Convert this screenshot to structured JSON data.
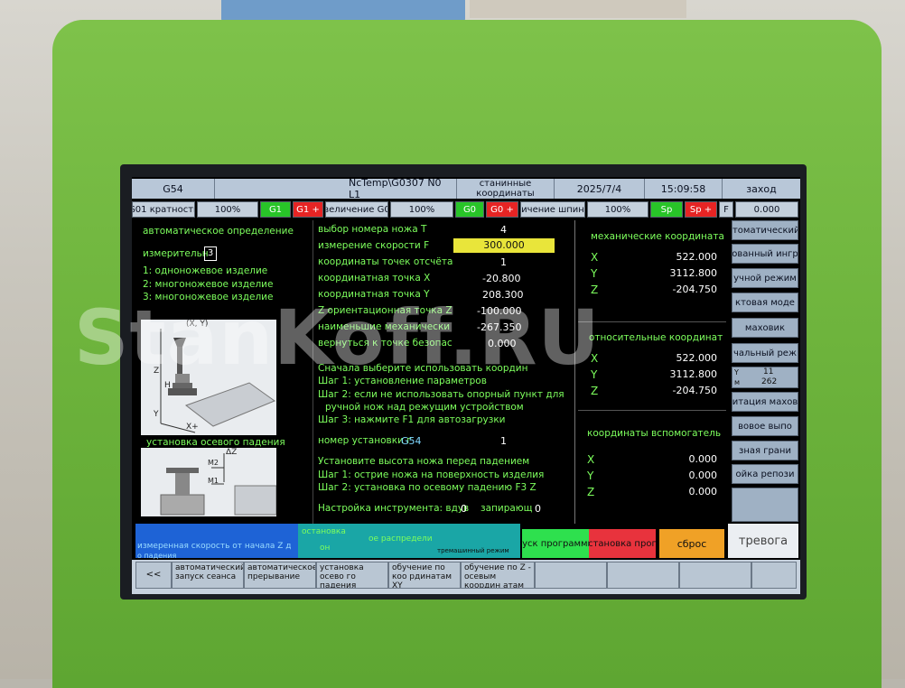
{
  "topbar": {
    "wcs": "G54",
    "program": "NcTemp\\G0307 N0 L1",
    "mode": "станинные координаты",
    "date": "2025/7/4",
    "time": "15:09:58",
    "status": "заход"
  },
  "overrides": {
    "g01_label": "G01 кратность",
    "g01_pct": "100%",
    "g1_btn": "G1",
    "g1_plus": "G1 +",
    "g0_label": "величение G0",
    "g0_pct": "100%",
    "g0_btn": "G0",
    "g0_plus": "G0 +",
    "sp_label": "ичение шпин",
    "sp_pct": "100%",
    "sp_btn": "Sp",
    "sp_plus": "Sp +",
    "f_label": "F",
    "f_value": "0.000"
  },
  "left_panel": {
    "heading": "автоматическое определение",
    "measure_label": "измерительн",
    "measure_value": "3",
    "opt1": "1: одноножевое изделие",
    "opt2": "2: многоножевое изделие",
    "opt3": "3: многоножевое изделие",
    "diagram_label": "(X, Y)",
    "axis_z": "Z",
    "axis_h": "H",
    "axis_y": "Y",
    "axis_x": "X+",
    "section2": "установка осевого падения",
    "dz": "ΔZ",
    "m2": "M2",
    "m1": "M1"
  },
  "params": [
    {
      "label": "выбор номера ножа T",
      "value": "4"
    },
    {
      "label": "измерение скорости F",
      "value": "300.000"
    },
    {
      "label": "координаты точек отсчёта",
      "value": "1"
    },
    {
      "label": "координатная точка X",
      "value": "-20.800"
    },
    {
      "label": "координатная точка Y",
      "value": "208.300"
    },
    {
      "label": "Z ориентационная точка Z",
      "value": "-100.000"
    },
    {
      "label": "наименьшие механически",
      "value": "-267.350"
    },
    {
      "label": "вернуться к точке безопас",
      "value": "0.000"
    }
  ],
  "instructions1": {
    "line1": "Сначала выберите использовать координ",
    "line2": "Шаг 1: установление параметров",
    "line3": "Шаг 2: если не использовать опорный пункт для",
    "line4": "ручной нож над режущим устройством",
    "line5": "Шаг 3: нажмите F1 для автозагрузки"
  },
  "install_no": {
    "label": "номер установки г",
    "code": "G54",
    "value": "1"
  },
  "instructions2": {
    "line1": "Установите высота ножа перед падением",
    "line2": "Шаг 1: острие ножа на поверхность изделия",
    "line3": "Шаг 2: установка по осевому падению F3 Z"
  },
  "setup_line": {
    "label": "Настройка инструмента: вдув",
    "v1": "0",
    "label2": "запирающ",
    "v2": "0"
  },
  "coords": {
    "mech_title": "механические координата",
    "mech": [
      {
        "axis": "X",
        "value": "522.000"
      },
      {
        "axis": "Y",
        "value": "3112.800"
      },
      {
        "axis": "Z",
        "value": "-204.750"
      }
    ],
    "rel_title": "относительные координат",
    "rel": [
      {
        "axis": "X",
        "value": "522.000"
      },
      {
        "axis": "Y",
        "value": "3112.800"
      },
      {
        "axis": "Z",
        "value": "-204.750"
      }
    ],
    "aux_title": "координаты вспомогатель",
    "aux": [
      {
        "axis": "X",
        "value": "0.000"
      },
      {
        "axis": "Y",
        "value": "0.000"
      },
      {
        "axis": "Z",
        "value": "0.000"
      }
    ]
  },
  "side_buttons": [
    "автоматический р",
    "ованный ингр",
    "учной режим",
    "ктовая моде",
    "маховик",
    "чальный реж"
  ],
  "side_y": {
    "y_label": "Y",
    "y_value": "11",
    "m_label": "м",
    "m_value": "262"
  },
  "side_buttons2": [
    "итация махов",
    "вовое выпо",
    "зная грани",
    "ойка репози"
  ],
  "status_row": {
    "msg1": "измеренная скорость от начала Z д",
    "msg1b": "о падения",
    "msg2": "остановка",
    "msg2b": "он",
    "msg3": "ое распредели",
    "msg4": "тремашинный режим",
    "btn_prog": "пуск программы",
    "btn_stop": "остановка прогр",
    "btn_reset": "сброс",
    "btn_alarm": "тревога"
  },
  "bottom_buttons": [
    {
      "label": "<<"
    },
    {
      "label": "автоматический запуск сеанса"
    },
    {
      "label": "автоматическое прерывание"
    },
    {
      "label": "установка осево го падения"
    },
    {
      "label": "обучение по коо рдинатам XY"
    },
    {
      "label": "обучение по Z - осевым координ атам"
    }
  ],
  "watermark": "StanKoff.RU"
}
